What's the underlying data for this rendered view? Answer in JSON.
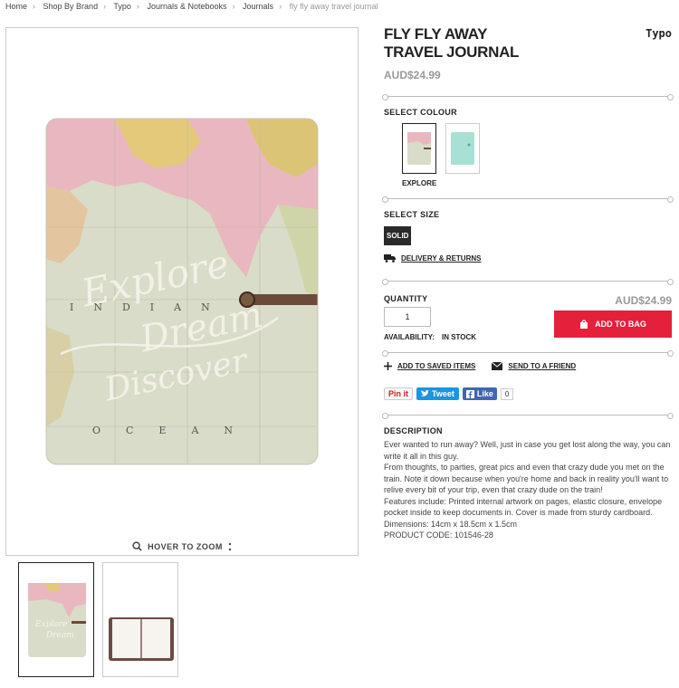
{
  "breadcrumb": {
    "items": [
      "Home",
      "Shop By Brand",
      "Typo",
      "Journals & Notebooks",
      "Journals"
    ],
    "current": "fly fly away travel journal"
  },
  "gallery": {
    "zoom_hint": "HOVER TO ZOOM",
    "cover_text": [
      "Explore",
      "Dream",
      "Discover"
    ],
    "map_text": [
      "INDIAN",
      "OCEAN"
    ]
  },
  "product": {
    "title": "FLY FLY AWAY TRAVEL JOURNAL",
    "brand": "Typo",
    "price": "AUD$24.99",
    "select_colour_label": "SELECT COLOUR",
    "selected_colour": "EXPLORE",
    "select_size_label": "SELECT SIZE",
    "size_option": "SOLID",
    "delivery_link": "DELIVERY & RETURNS",
    "quantity_label": "QUANTITY",
    "quantity_value": "1",
    "availability_label": "AVAILABILITY:",
    "availability_value": "IN STOCK",
    "price_right": "AUD$24.99",
    "add_to_bag": "ADD TO BAG",
    "add_saved": "ADD TO SAVED ITEMS",
    "send_friend": "SEND TO A FRIEND"
  },
  "social": {
    "pin": "Pin it",
    "tweet": "Tweet",
    "like": "Like",
    "like_count": "0"
  },
  "description": {
    "heading": "DESCRIPTION",
    "paragraphs": [
      "Ever wanted to run away? Well, just in case you get lost along the way, you can write it all in this guy.",
      "From thoughts, to parties, great pics and even that crazy dude you met on the train. Note it down because when you're home and back in reality you'll want to relive every bit of your trip, even that crazy dude on the train!",
      "Features include: Printed internal artwork on pages, elastic closure, envelope pocket inside to keep documents in. Cover is made from sturdy cardboard.",
      "Dimensions: 14cm x 18.5cm x 1.5cm",
      "PRODUCT CODE: 101546-28"
    ]
  },
  "colors": {
    "accent": "#e4203b",
    "mint_swatch": "#a8e0d4"
  }
}
